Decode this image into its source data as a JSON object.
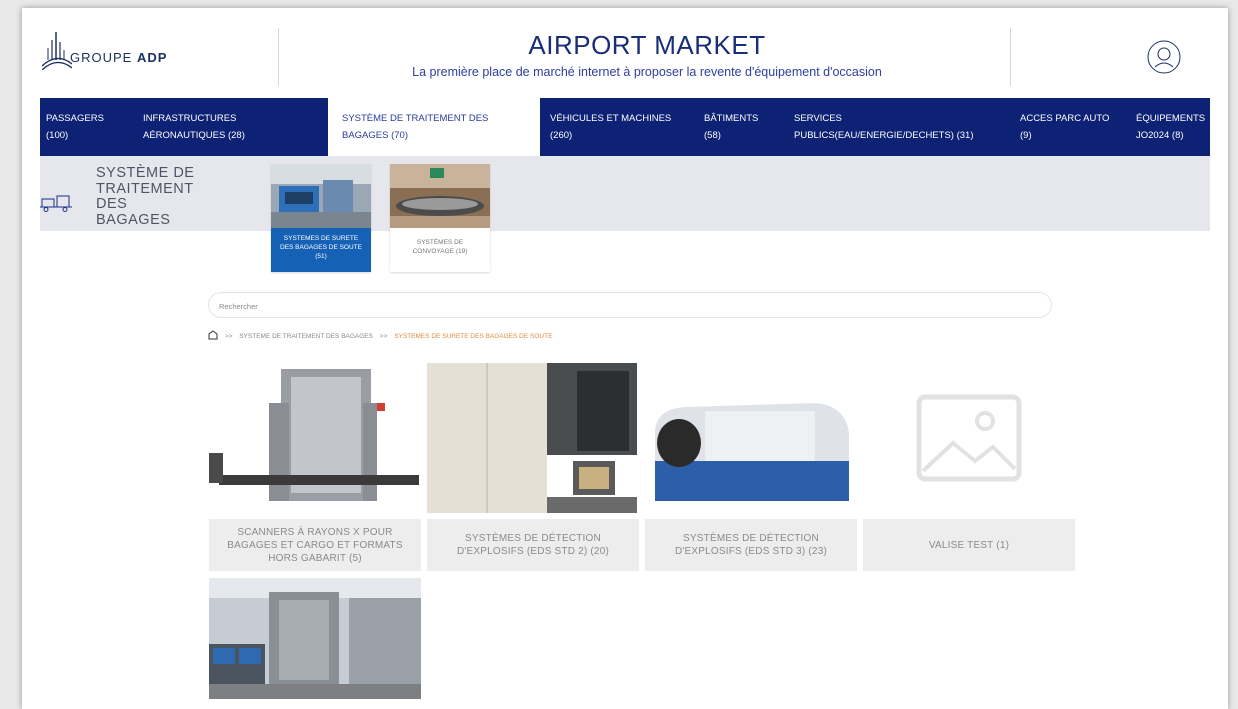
{
  "brand": {
    "name_light": "GROUPE",
    "name_bold": "ADP"
  },
  "header": {
    "title": "AIRPORT MARKET",
    "subtitle": "La première place de marché internet à proposer la revente d'équipement d'occasion"
  },
  "nav": [
    {
      "line1": "PASSAGERS",
      "line2": "(100)"
    },
    {
      "line1": "INFRASTRUCTURES",
      "line2": "AÉRONAUTIQUES (28)"
    },
    {
      "line1": "SYSTÈME DE TRAITEMENT DES",
      "line2": "BAGAGES (70)",
      "active": true
    },
    {
      "line1": "VÉHICULES ET MACHINES",
      "line2": "(260)"
    },
    {
      "line1": "BÂTIMENTS",
      "line2": "(58)"
    },
    {
      "line1": "SERVICES",
      "line2": "PUBLICS(EAU/ENERGIE/DECHETS) (31)"
    },
    {
      "line1": "ACCES PARC AUTO",
      "line2": "(9)"
    },
    {
      "line1": "ÉQUIPEMENTS",
      "line2": "JO2024 (8)"
    }
  ],
  "category": {
    "title_lines": [
      "SYSTÈME DE",
      "TRAITEMENT",
      "DES",
      "BAGAGES"
    ],
    "icon": "baggage-cart-icon"
  },
  "subcategories": [
    {
      "label": "SYSTEMES DE SURETE DES BAGAGES DE SOUTE (51)",
      "active": true
    },
    {
      "label": "SYSTÈMES DE CONVOYAGE (19)",
      "active": false
    }
  ],
  "search": {
    "placeholder": "Rechercher"
  },
  "breadcrumb": {
    "icon": "home-icon",
    "separator": ">>",
    "items": [
      "SYSTEME DE TRAITEMENT DES BAGAGES",
      "SYSTEMES DE SURETE DES BAGAGES DE SOUTE"
    ]
  },
  "products": [
    {
      "label": "SCANNERS À RAYONS X POUR BAGAGES ET CARGO ET FORMATS HORS GABARIT (5)"
    },
    {
      "label": "SYSTÈMES DE DÉTECTION D'EXPLOSIFS (EDS STD 2) (20)"
    },
    {
      "label": "SYSTÈMES DE DÉTECTION D'EXPLOSIFS (EDS STD 3) (23)"
    },
    {
      "label": "VALISE TEST (1)"
    }
  ],
  "colors": {
    "nav_bg": "#0d2175",
    "active_tile": "#1561b6",
    "breadcrumb_current": "#e08b3b",
    "title": "#1a2e78"
  }
}
